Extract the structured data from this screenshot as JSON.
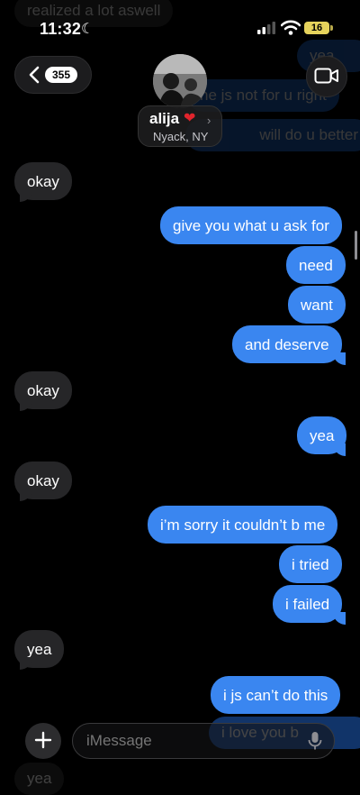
{
  "status_bar": {
    "time": "11:32",
    "battery": "16"
  },
  "header": {
    "back_count": "355",
    "contact_name": "alija",
    "contact_location": "Nyack, NY"
  },
  "ghost_messages": {
    "top_in": "realized a lot aswell",
    "top_out_1": "yea",
    "top_out_2": "he js not for u right",
    "top_out_3": "will do u better",
    "bottom_out": "i love you b",
    "bottom_in": "yea"
  },
  "messages": [
    {
      "text": "okay",
      "dir": "in"
    },
    {
      "text": "give you what u ask for",
      "dir": "out"
    },
    {
      "text": "need",
      "dir": "out"
    },
    {
      "text": "want",
      "dir": "out"
    },
    {
      "text": "and deserve",
      "dir": "out"
    },
    {
      "text": "okay",
      "dir": "in"
    },
    {
      "text": "yea",
      "dir": "out"
    },
    {
      "text": "okay",
      "dir": "in"
    },
    {
      "text": "i’m sorry it couldn’t b me",
      "dir": "out"
    },
    {
      "text": "i tried",
      "dir": "out"
    },
    {
      "text": "i failed",
      "dir": "out"
    },
    {
      "text": "yea",
      "dir": "in"
    },
    {
      "text": "i js can’t do this",
      "dir": "out"
    }
  ],
  "composer": {
    "placeholder": "iMessage"
  },
  "colors": {
    "outgoing": "#3a86f0",
    "incoming": "#262628",
    "background": "#000000"
  }
}
